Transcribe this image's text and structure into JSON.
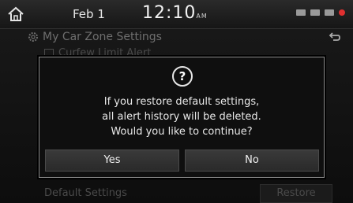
{
  "status_bar": {
    "date": "Feb  1",
    "time": "12:10",
    "time_suffix": "AM",
    "icons": [
      "usb-icon",
      "bluetooth-icon",
      "signal-icon",
      "record-icon"
    ]
  },
  "title": "My Car Zone Settings",
  "background_item": "Curfew Limit Alert",
  "footer": {
    "label": "Default Settings",
    "restore": "Restore"
  },
  "dialog": {
    "icon": "?",
    "message_line1": "If you restore default settings,",
    "message_line2": "all alert history will be deleted.",
    "message_line3": "Would you like to continue?",
    "yes_label": "Yes",
    "no_label": "No"
  },
  "colors": {
    "accent_red": "#e03030",
    "text": "#e8e8e8",
    "dimmed": "#4a4a4a"
  }
}
